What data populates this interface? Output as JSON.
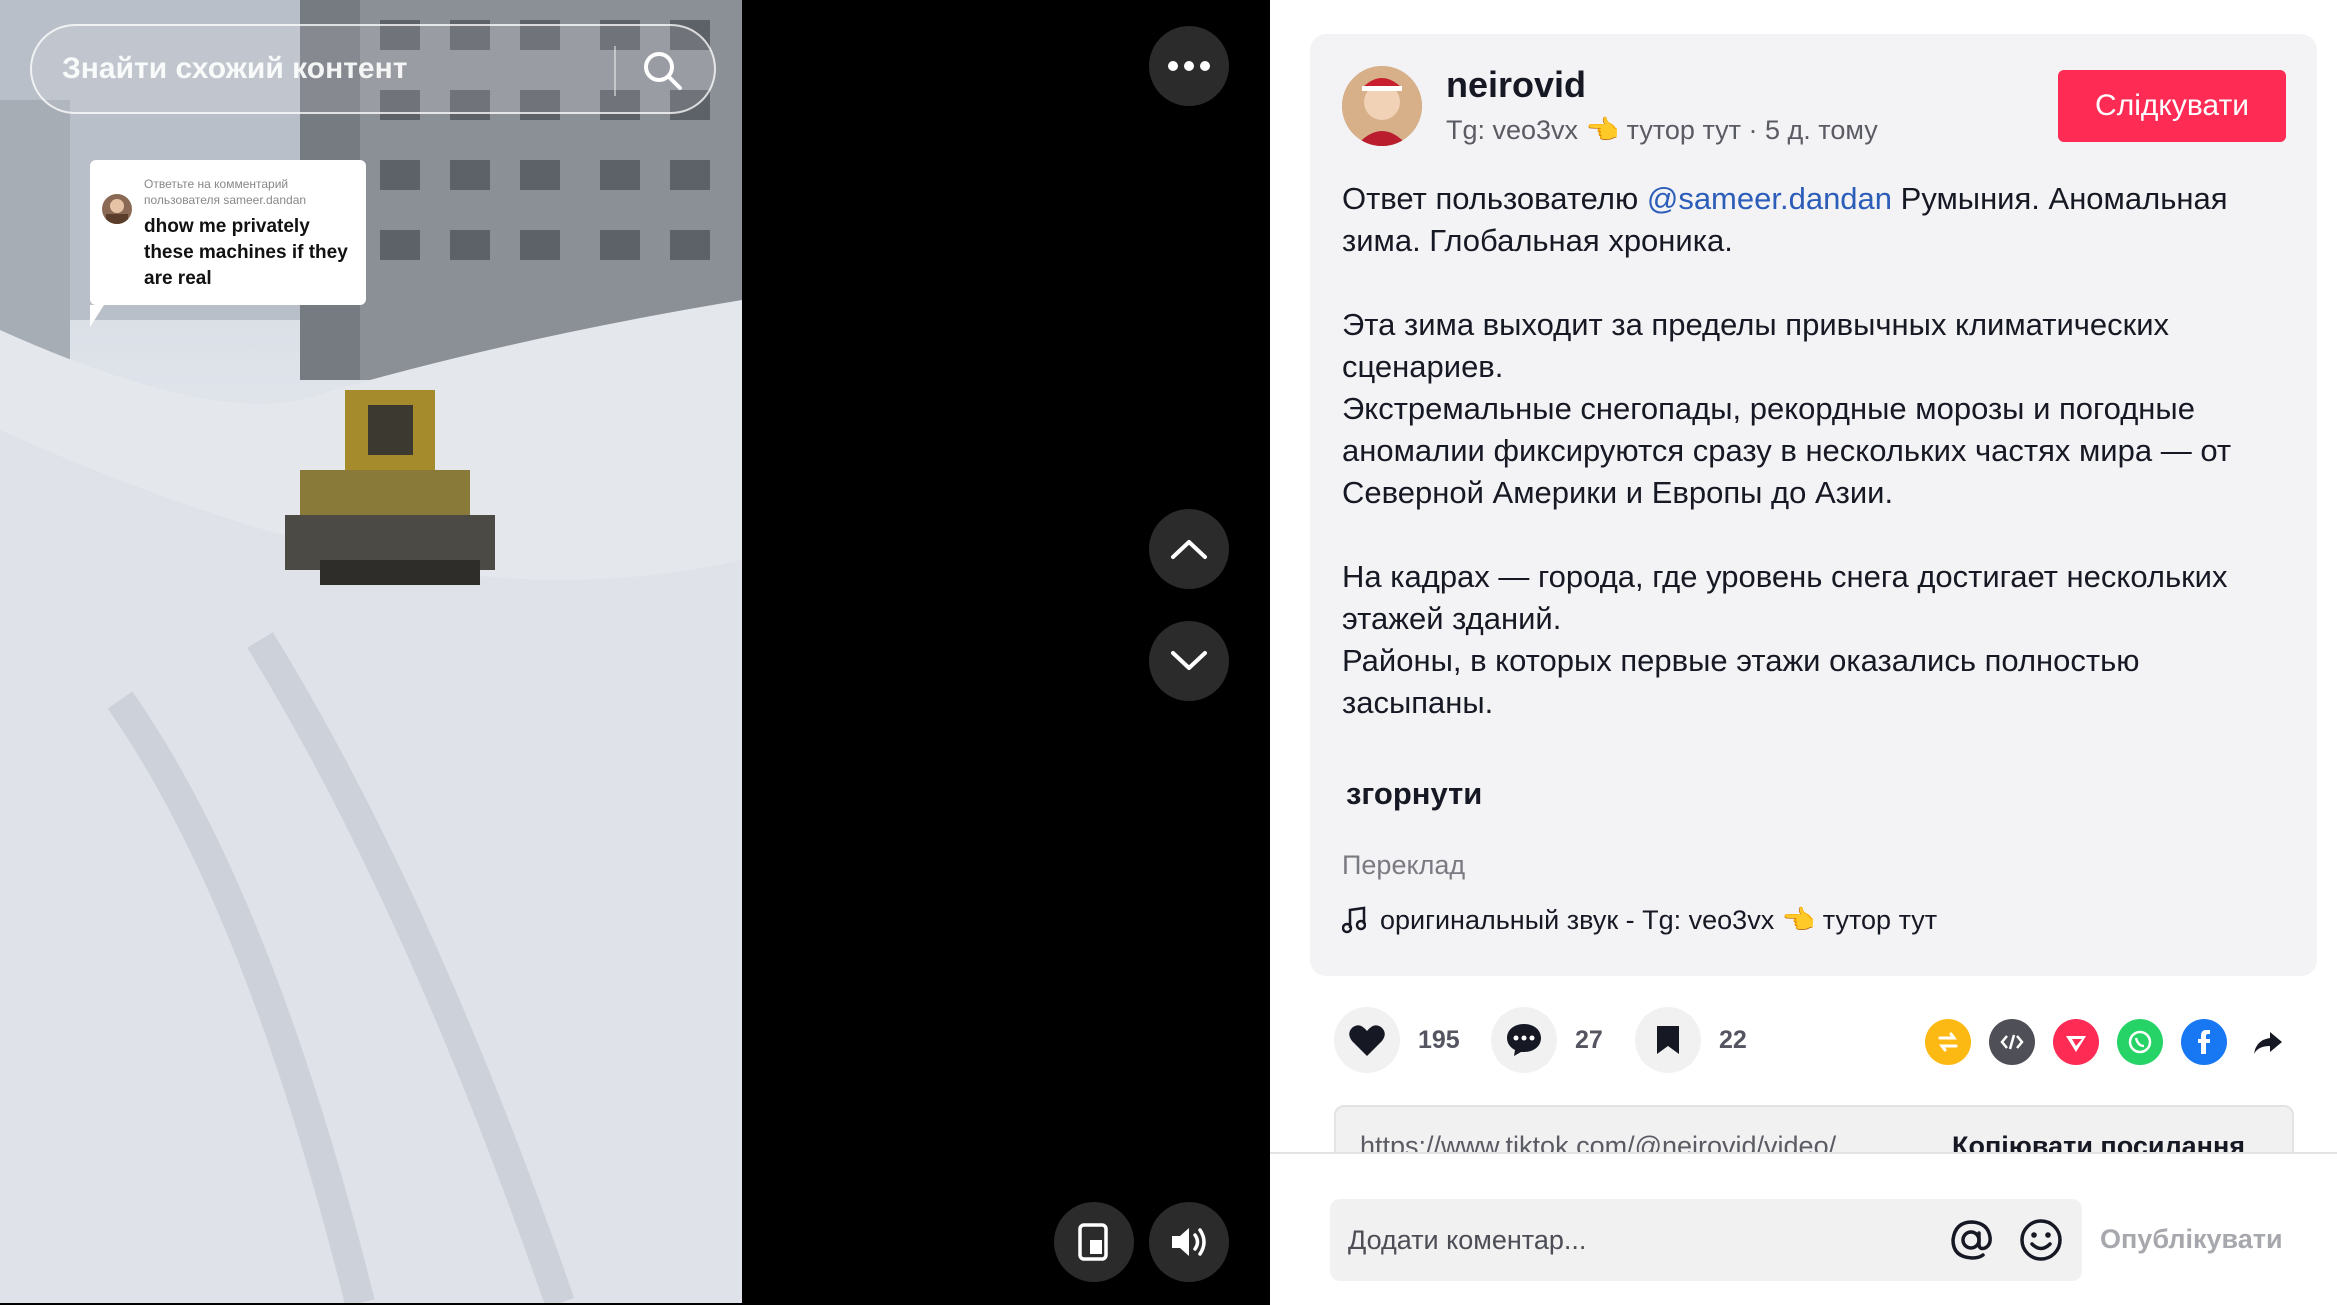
{
  "video": {
    "search_placeholder": "Знайти схожий контент",
    "reply_header": "Ответьте на комментарий пользователя sameer.dandan",
    "reply_text": "dhow me privately these machines if they are real"
  },
  "post": {
    "author": "neirovid",
    "meta": "Tg: veo3vx 👈 тутор тут · 5 д. тому",
    "follow_label": "Слідкувати",
    "caption_prefix": "Ответ пользователю ",
    "caption_mention": "@sameer.dandan",
    "caption_suffix": " Румыния. Аномальная зима. Глобальная хроника.",
    "caption_p2": "Эта зима выходит за пределы привычных климатических сценариев.\nЭкстремальные снегопады, рекордные морозы и погодные аномалии фиксируются сразу в нескольких частях мира — от Северной Америки и Европы до Азии.",
    "caption_p3": "На кадрах — города, где уровень снега достигает нескольких этажей зданий.\nРайоны, в которых первые этажи оказались полностью засыпаны.",
    "collapse_label": "згорнути",
    "translate_label": "Переклад",
    "sound_label": "оригинальный звук - Tg: veo3vx 👈 тутор тут"
  },
  "actions": {
    "likes": "195",
    "comments": "27",
    "saves": "22"
  },
  "share_icons": [
    "repost-icon",
    "embed-icon",
    "telegram-send-icon",
    "whatsapp-icon",
    "facebook-icon",
    "share-arrow-icon"
  ],
  "colors": {
    "accent": "#fe2c55",
    "mention": "#2b5db9"
  },
  "link": {
    "url": "https://www.tiktok.com/@neirovid/video/...",
    "copy_label": "Копіювати посилання"
  },
  "comment": {
    "placeholder": "Додати коментар...",
    "post_label": "Опублікувати"
  }
}
